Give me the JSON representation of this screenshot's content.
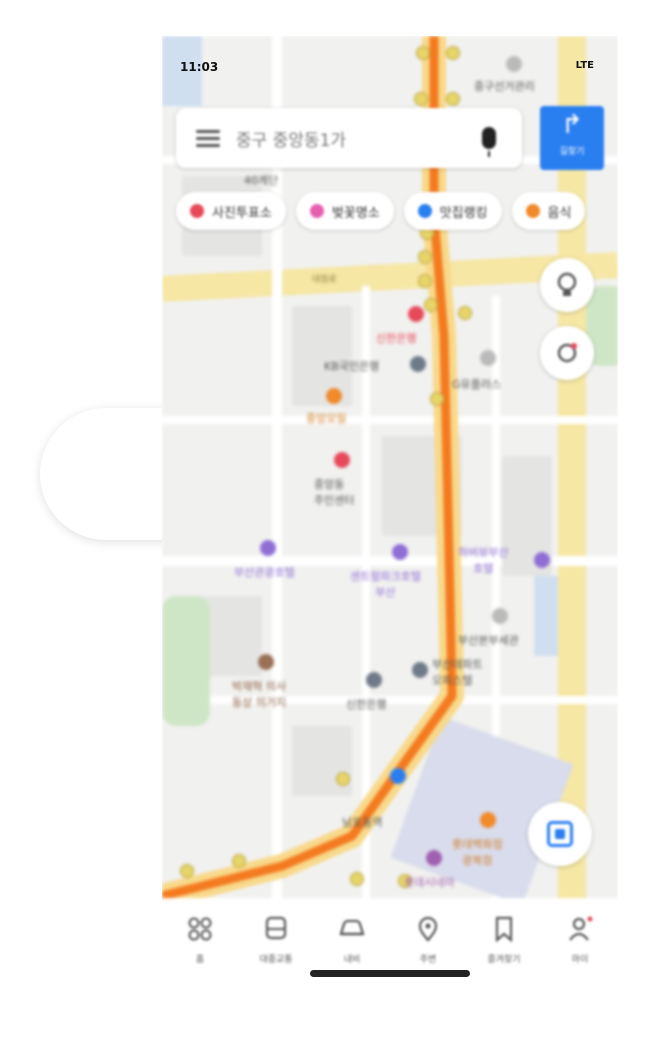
{
  "status_bar": {
    "time": "11:03",
    "signal": "LTE"
  },
  "search": {
    "text": "중구 중앙동1가"
  },
  "route_button": {
    "label": "길찾기"
  },
  "chips": [
    {
      "label": "사진투표소",
      "color": "#e8495a"
    },
    {
      "label": "벚꽃명소",
      "color": "#e85fb0"
    },
    {
      "label": "맛집랭킹",
      "color": "#2a7ff0"
    },
    {
      "label": "음식",
      "color": "#f08a2a"
    }
  ],
  "map": {
    "labels": {
      "top_poi": "중구선거관리",
      "top_left": "40계단",
      "street": "대청로",
      "shinhan_top": "신한은행",
      "kb": "KB국민은행",
      "plaza": "G유플러스",
      "restaurant": "중앙모밀",
      "center": "중앙동\n주민센터",
      "busan_post": "부산관광호텔",
      "sendo": "센트럴파크호텔\n부산",
      "harbor_hotel": "하버뷰부산\n호텔",
      "customs": "부산본부세관",
      "museum": "박재혁 의사\n동상 의거지",
      "shinhan_bottom": "신한은행",
      "tower": "부산데파트\n오피스텔",
      "station": "남포동역",
      "lotte": "롯데백화점\n광복점",
      "mart": "롯데시네마"
    }
  },
  "bottom_nav": [
    {
      "label": "홈",
      "icon": "grid-icon"
    },
    {
      "label": "대중교통",
      "icon": "bus-icon"
    },
    {
      "label": "내비",
      "icon": "car-icon"
    },
    {
      "label": "주변",
      "icon": "pin-icon"
    },
    {
      "label": "즐겨찾기",
      "icon": "bookmark-icon"
    },
    {
      "label": "마이",
      "icon": "person-icon"
    }
  ],
  "colors": {
    "route": "#f47a1f",
    "accent": "#2a7ff0",
    "road": "#f6e7a4"
  }
}
